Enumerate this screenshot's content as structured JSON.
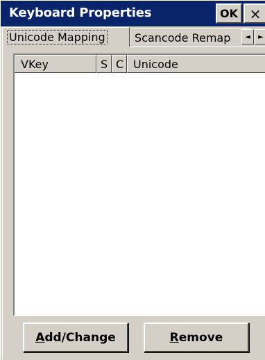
{
  "window": {
    "title": "Keyboard Properties",
    "ok_label": "OK",
    "close_glyph": "×"
  },
  "tabs": [
    {
      "label": "Unicode Mapping",
      "active": true
    },
    {
      "label": "Scancode Remap",
      "active": false
    }
  ],
  "tab_scroll": {
    "left_glyph": "◄",
    "right_glyph": "►"
  },
  "list": {
    "columns": [
      "VKey",
      "S",
      "C",
      "Unicode"
    ],
    "rows": []
  },
  "buttons": {
    "add_change": {
      "mnemonic": "A",
      "rest": "dd/Change"
    },
    "remove": {
      "mnemonic": "R",
      "rest": "emove"
    }
  },
  "colors": {
    "titlebar": "#0a246a",
    "face": "#d4d0c8",
    "list_bg": "#ffffff"
  }
}
